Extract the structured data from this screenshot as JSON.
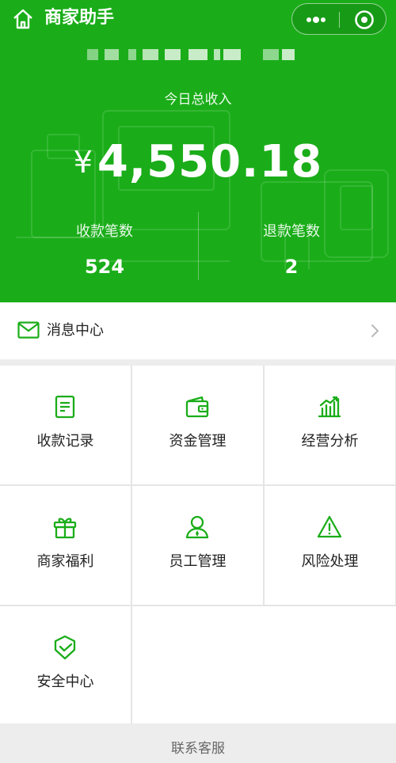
{
  "header": {
    "title": "商家助手",
    "home_icon": "home-icon",
    "more_icon": "more-dots-icon",
    "close_icon": "miniprogram-close-icon",
    "background_color": "#1aad19"
  },
  "summary": {
    "income_label": "今日总收入",
    "currency_symbol": "¥",
    "income_amount": "4,550.18",
    "payments_label": "收款笔数",
    "payments_count": "524",
    "refunds_label": "退款笔数",
    "refunds_count": "2"
  },
  "message_center": {
    "label": "消息中心",
    "icon": "mail-icon",
    "chevron_icon": "chevron-right-icon"
  },
  "menu": [
    {
      "label": "收款记录",
      "icon": "receipt-icon"
    },
    {
      "label": "资金管理",
      "icon": "wallet-icon"
    },
    {
      "label": "经营分析",
      "icon": "bar-chart-icon"
    },
    {
      "label": "商家福利",
      "icon": "gift-icon"
    },
    {
      "label": "员工管理",
      "icon": "staff-icon"
    },
    {
      "label": "风险处理",
      "icon": "warning-icon"
    },
    {
      "label": "安全中心",
      "icon": "shield-icon"
    }
  ],
  "footer": {
    "link": "联系客服"
  },
  "colors": {
    "accent": "#1aad19",
    "icon_green": "#1aad19"
  }
}
